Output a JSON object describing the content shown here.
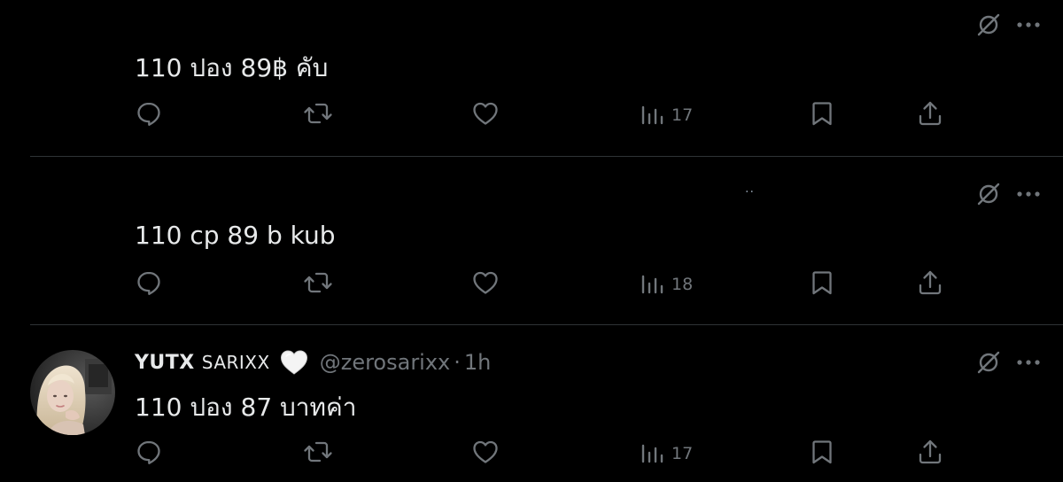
{
  "tweets": [
    {
      "text": "110 ปอง 89฿ คับ",
      "views": "17"
    },
    {
      "text": "110 cp 89 b kub",
      "views": "18",
      "stray_text": ".."
    },
    {
      "display_name": "YUTX",
      "display_name_2": "SARIXX",
      "handle": "@zerosarixx",
      "separator": "·",
      "timestamp": "1h",
      "text": "110 ปอง 87 บาทค่า",
      "views": "17"
    }
  ],
  "icons": {
    "grok": "grok-icon",
    "more": "more-dots-icon",
    "reply": "reply-icon",
    "retweet": "retweet-icon",
    "like": "like-icon",
    "views": "views-icon",
    "bookmark": "bookmark-icon",
    "share": "share-icon",
    "name_emoji": "white-heart-icon"
  },
  "colors": {
    "background": "#000000",
    "text_primary": "#e7e9ea",
    "text_secondary": "#71767b",
    "divider": "#2f3336"
  }
}
